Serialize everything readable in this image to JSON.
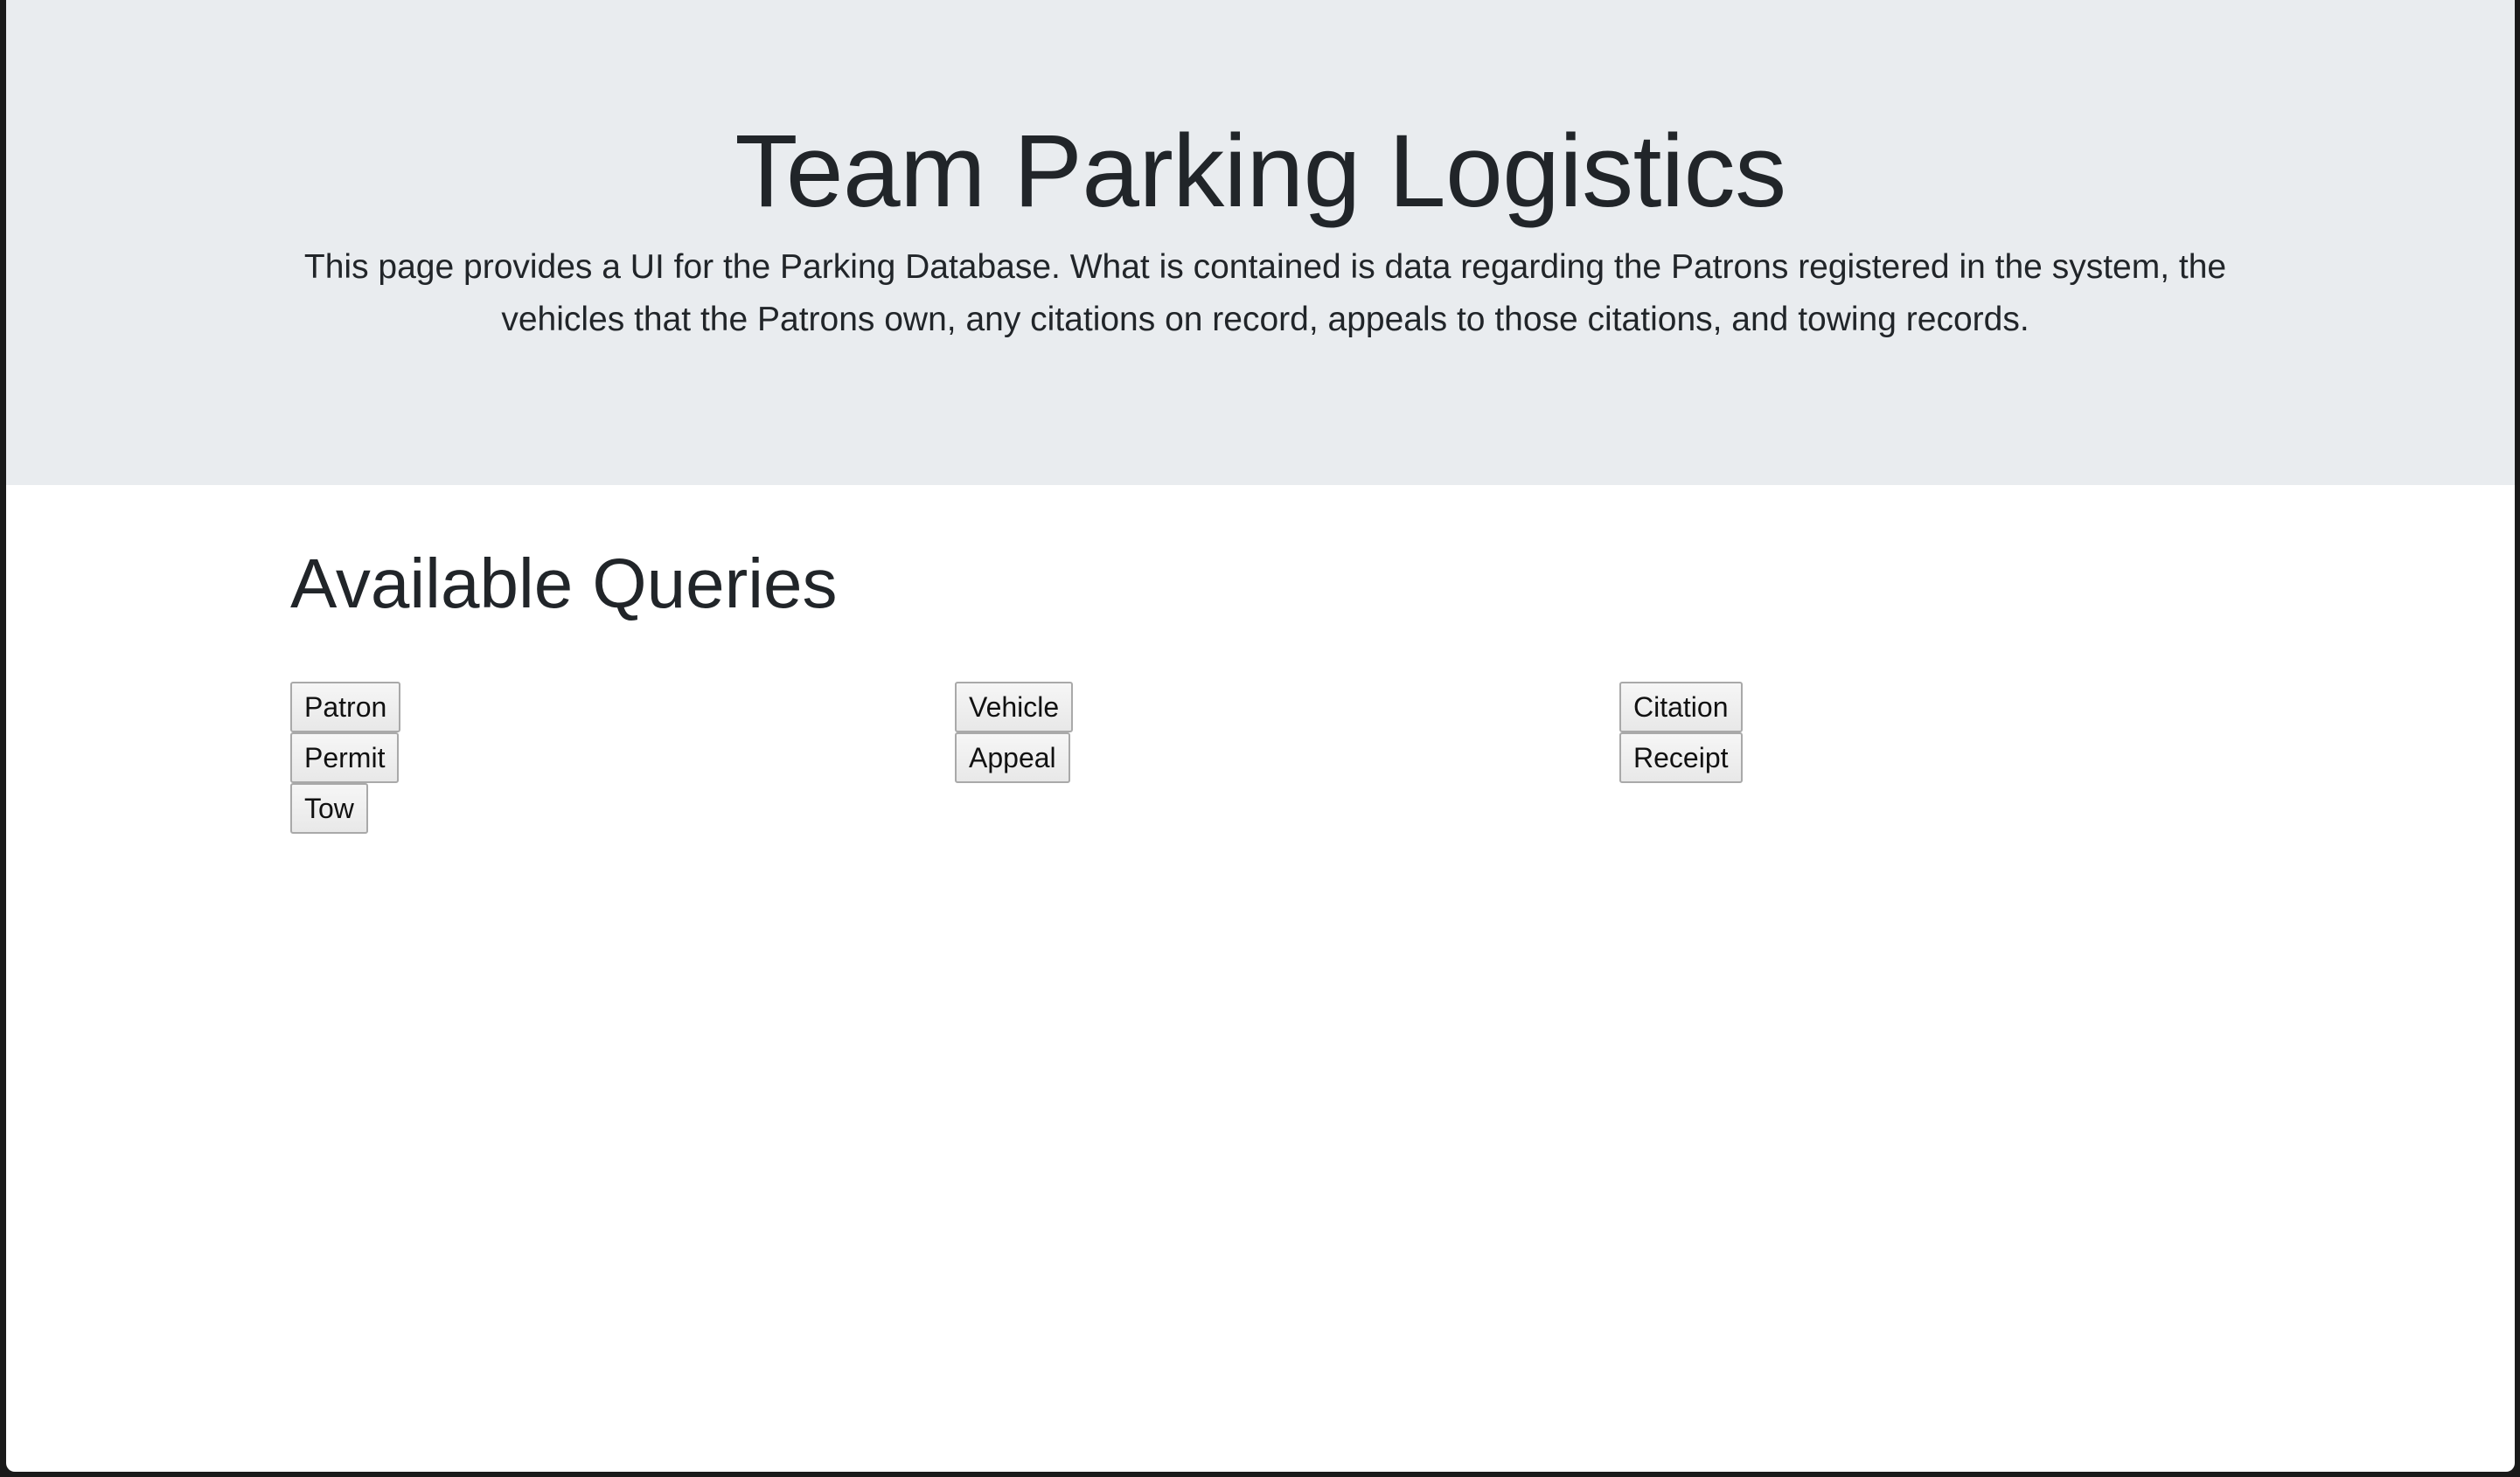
{
  "header": {
    "title": "Team Parking Logistics",
    "description": "This page provides a UI for the Parking Database. What is contained is data regarding the Patrons registered in the system, the vehicles that the Patrons own, any citations on record, appeals to those citations, and towing records."
  },
  "queries": {
    "heading": "Available Queries",
    "column1": [
      "Patron",
      "Permit",
      "Tow"
    ],
    "column2": [
      "Vehicle",
      "Appeal"
    ],
    "column3": [
      "Citation",
      "Receipt"
    ]
  },
  "colors": {
    "jumbotron_bg": "#e9ecef",
    "page_bg": "#ffffff",
    "text": "#212529"
  }
}
